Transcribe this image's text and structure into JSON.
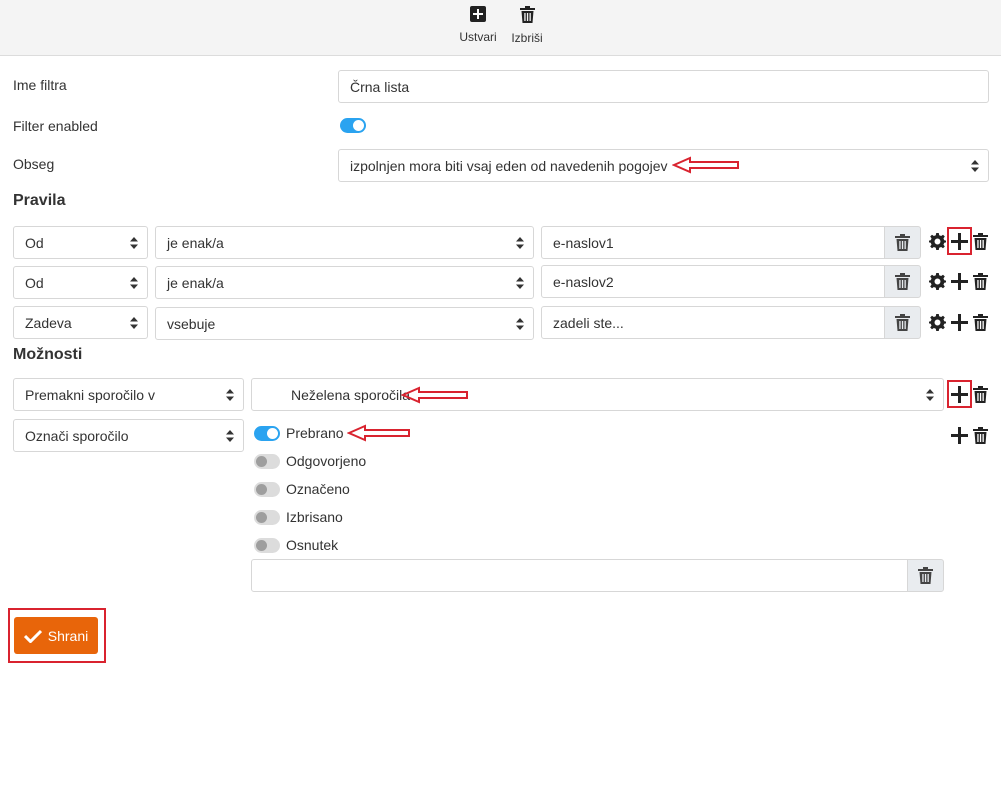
{
  "toolbar": {
    "create_label": "Ustvari",
    "delete_label": "Izbriši"
  },
  "form": {
    "name_label": "Ime filtra",
    "name_value": "Črna lista",
    "enabled_label": "Filter enabled",
    "enabled": true,
    "scope_label": "Obseg",
    "scope_value": "izpolnjen mora biti vsaj eden od navedenih pogojev"
  },
  "rules": {
    "heading": "Pravila",
    "rows": [
      {
        "field": "Od",
        "operator": "je enak/a",
        "value": "e-naslov1"
      },
      {
        "field": "Od",
        "operator": "je enak/a",
        "value": "e-naslov2"
      },
      {
        "field": "Zadeva",
        "operator": "vsebuje",
        "value": "zadeli ste..."
      }
    ]
  },
  "options": {
    "heading": "Možnosti",
    "move_action": "Premakni sporočilo v",
    "move_folder": "Nežele​na sporočila",
    "mark_action": "Označi sporočilo",
    "flags": [
      {
        "label": "Prebrano",
        "on": true
      },
      {
        "label": "Odgovorjeno",
        "on": false
      },
      {
        "label": "Označeno",
        "on": false
      },
      {
        "label": "Izbrisano",
        "on": false
      },
      {
        "label": "Osnutek",
        "on": false
      }
    ],
    "extra_value": ""
  },
  "save_label": "Shrani",
  "colors": {
    "accent": "#e8650a",
    "toggle_on": "#2aa3f0",
    "annotation_red": "#d9232f"
  }
}
